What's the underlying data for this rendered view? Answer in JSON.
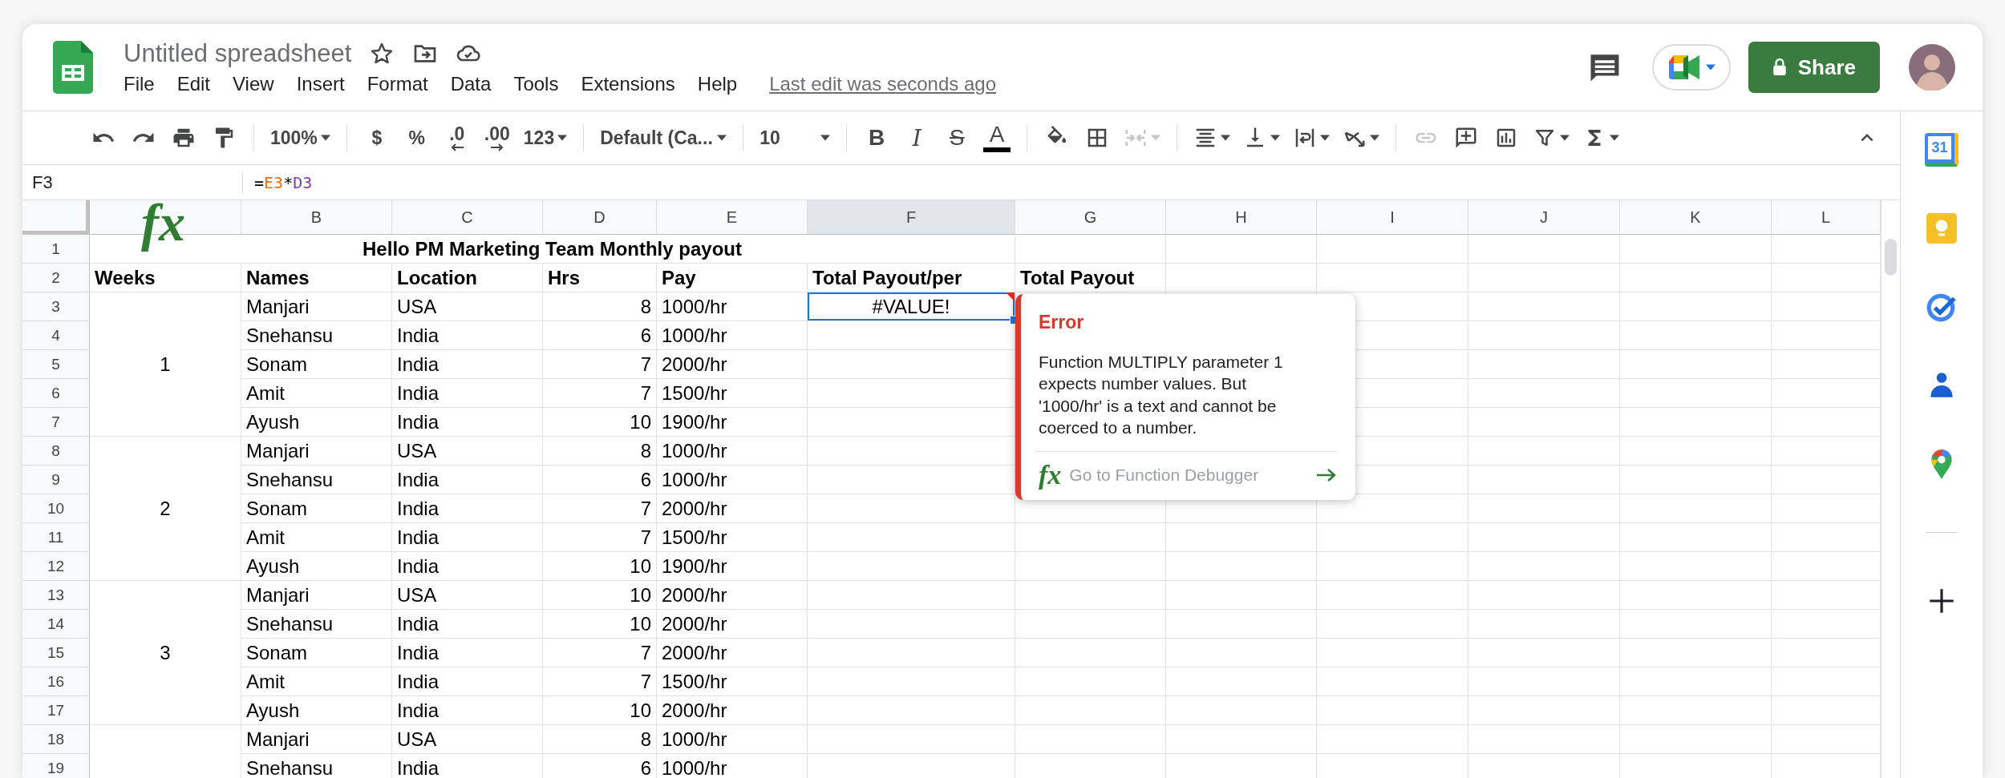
{
  "app": {
    "title": "Untitled spreadsheet",
    "menu": [
      "File",
      "Edit",
      "View",
      "Insert",
      "Format",
      "Data",
      "Tools",
      "Extensions",
      "Help"
    ],
    "last_edit": "Last edit was seconds ago",
    "share": "Share"
  },
  "toolbar": [
    {
      "kind": "undo",
      "caret": false,
      "disabled": false
    },
    {
      "kind": "redo",
      "caret": false,
      "disabled": false
    },
    {
      "kind": "print",
      "caret": false,
      "disabled": false
    },
    {
      "kind": "paint-format",
      "caret": false,
      "disabled": false
    },
    {
      "kind": "separator"
    },
    {
      "kind": "zoom",
      "text": "100%",
      "caret": true,
      "disabled": false
    },
    {
      "kind": "separator"
    },
    {
      "kind": "currency",
      "text": "$",
      "caret": false,
      "disabled": false
    },
    {
      "kind": "percent",
      "text": "%",
      "caret": false,
      "disabled": false
    },
    {
      "kind": "decimal-less",
      "text": ".0",
      "caret": false,
      "disabled": false
    },
    {
      "kind": "decimal-more",
      "text": ".00",
      "caret": false,
      "disabled": false
    },
    {
      "kind": "number-format",
      "text": "123",
      "caret": true,
      "disabled": false
    },
    {
      "kind": "separator"
    },
    {
      "kind": "font",
      "text": "Default (Ca...",
      "caret": true,
      "disabled": false
    },
    {
      "kind": "separator"
    },
    {
      "kind": "font-size",
      "text": "10",
      "caret": true,
      "disabled": false
    },
    {
      "kind": "separator"
    },
    {
      "kind": "bold",
      "text": "B",
      "caret": false,
      "disabled": false
    },
    {
      "kind": "italic",
      "text": "I",
      "caret": false,
      "disabled": false
    },
    {
      "kind": "strike",
      "text": "S",
      "caret": false,
      "disabled": false
    },
    {
      "kind": "text-color",
      "text": "A",
      "caret": false,
      "disabled": false
    },
    {
      "kind": "separator"
    },
    {
      "kind": "fill",
      "caret": false,
      "disabled": false
    },
    {
      "kind": "borders",
      "caret": false,
      "disabled": false
    },
    {
      "kind": "merge",
      "caret": true,
      "disabled": true
    },
    {
      "kind": "separator"
    },
    {
      "kind": "align",
      "caret": true,
      "disabled": false
    },
    {
      "kind": "valign",
      "caret": true,
      "disabled": false
    },
    {
      "kind": "wrap",
      "caret": true,
      "disabled": false
    },
    {
      "kind": "rotate",
      "caret": true,
      "disabled": false
    },
    {
      "kind": "separator"
    },
    {
      "kind": "link",
      "caret": false,
      "disabled": true
    },
    {
      "kind": "comment",
      "caret": false,
      "disabled": false
    },
    {
      "kind": "chart",
      "caret": false,
      "disabled": false
    },
    {
      "kind": "filter",
      "caret": true,
      "disabled": false
    },
    {
      "kind": "functions",
      "caret": true,
      "disabled": false
    },
    {
      "kind": "collapse",
      "caret": false,
      "disabled": false
    }
  ],
  "formula_bar": {
    "name_box": "F3",
    "fx": "fx",
    "tokens": [
      {
        "text": "="
      },
      {
        "text": "E3",
        "color": "#e8710a"
      },
      {
        "text": "*"
      },
      {
        "text": "D3",
        "color": "#7b3fb0"
      }
    ]
  },
  "columns": [
    {
      "label": "B",
      "selected": false
    },
    {
      "label": "C",
      "selected": false
    },
    {
      "label": "D",
      "selected": false
    },
    {
      "label": "E",
      "selected": false
    },
    {
      "label": "F",
      "selected": true
    },
    {
      "label": "G",
      "selected": false
    },
    {
      "label": "H",
      "selected": false
    },
    {
      "label": "I",
      "selected": false
    },
    {
      "label": "J",
      "selected": false
    },
    {
      "label": "K",
      "selected": false
    },
    {
      "label": "L",
      "selected": false
    }
  ],
  "row_numbers": [
    "1",
    "2",
    "3",
    "4",
    "5",
    "6",
    "7",
    "8",
    "9",
    "10",
    "11",
    "12",
    "13",
    "14",
    "15",
    "16",
    "17",
    "18",
    "19"
  ],
  "sheet": {
    "title": "Hello PM Marketing Team Monthly payout",
    "headers": [
      "Weeks",
      "Names",
      "Location",
      "Hrs",
      "Pay",
      "Total Payout/per",
      "Total Payout"
    ],
    "weeks": [
      {
        "week": "1",
        "rows": [
          {
            "name": "Manjari",
            "location": "USA",
            "hrs": "8",
            "pay": "1000/hr",
            "payout": "#VALUE!",
            "selected": true
          },
          {
            "name": "Snehansu",
            "location": "India",
            "hrs": "6",
            "pay": "1000/hr",
            "selected": false
          },
          {
            "name": "Sonam",
            "location": "India",
            "hrs": "7",
            "pay": "2000/hr",
            "selected": false
          },
          {
            "name": "Amit",
            "location": "India",
            "hrs": "7",
            "pay": "1500/hr",
            "selected": false
          },
          {
            "name": "Ayush",
            "location": "India",
            "hrs": "10",
            "pay": "1900/hr",
            "selected": false
          }
        ]
      },
      {
        "week": "2",
        "rows": [
          {
            "name": "Manjari",
            "location": "USA",
            "hrs": "8",
            "pay": "1000/hr",
            "selected": false
          },
          {
            "name": "Snehansu",
            "location": "India",
            "hrs": "6",
            "pay": "1000/hr",
            "selected": false
          },
          {
            "name": "Sonam",
            "location": "India",
            "hrs": "7",
            "pay": "2000/hr",
            "selected": false
          },
          {
            "name": "Amit",
            "location": "India",
            "hrs": "7",
            "pay": "1500/hr",
            "selected": false
          },
          {
            "name": "Ayush",
            "location": "India",
            "hrs": "10",
            "pay": "1900/hr",
            "selected": false
          }
        ]
      },
      {
        "week": "3",
        "rows": [
          {
            "name": "Manjari",
            "location": "USA",
            "hrs": "10",
            "pay": "2000/hr",
            "selected": false
          },
          {
            "name": "Snehansu",
            "location": "India",
            "hrs": "10",
            "pay": "2000/hr",
            "selected": false
          },
          {
            "name": "Sonam",
            "location": "India",
            "hrs": "7",
            "pay": "2000/hr",
            "selected": false
          },
          {
            "name": "Amit",
            "location": "India",
            "hrs": "7",
            "pay": "1500/hr",
            "selected": false
          },
          {
            "name": "Ayush",
            "location": "India",
            "hrs": "10",
            "pay": "2000/hr",
            "selected": false
          }
        ]
      },
      {
        "rows": [
          {
            "name": "Manjari",
            "location": "USA",
            "hrs": "8",
            "pay": "1000/hr",
            "selected": false
          },
          {
            "name": "Snehansu",
            "location": "India",
            "hrs": "6",
            "pay": "1000/hr",
            "selected": false
          }
        ]
      }
    ]
  },
  "error_popup": {
    "title": "Error",
    "message": "Function MULTIPLY parameter 1 expects number values. But '1000/hr' is a text and cannot be coerced to a number.",
    "fx": "fx",
    "link": "Go to Function Debugger"
  },
  "side_panel": [
    {
      "kind": "calendar",
      "text": "31"
    },
    {
      "kind": "keep"
    },
    {
      "kind": "tasks"
    },
    {
      "kind": "contacts"
    },
    {
      "kind": "maps"
    },
    {
      "kind": "divider"
    },
    {
      "kind": "add"
    }
  ]
}
